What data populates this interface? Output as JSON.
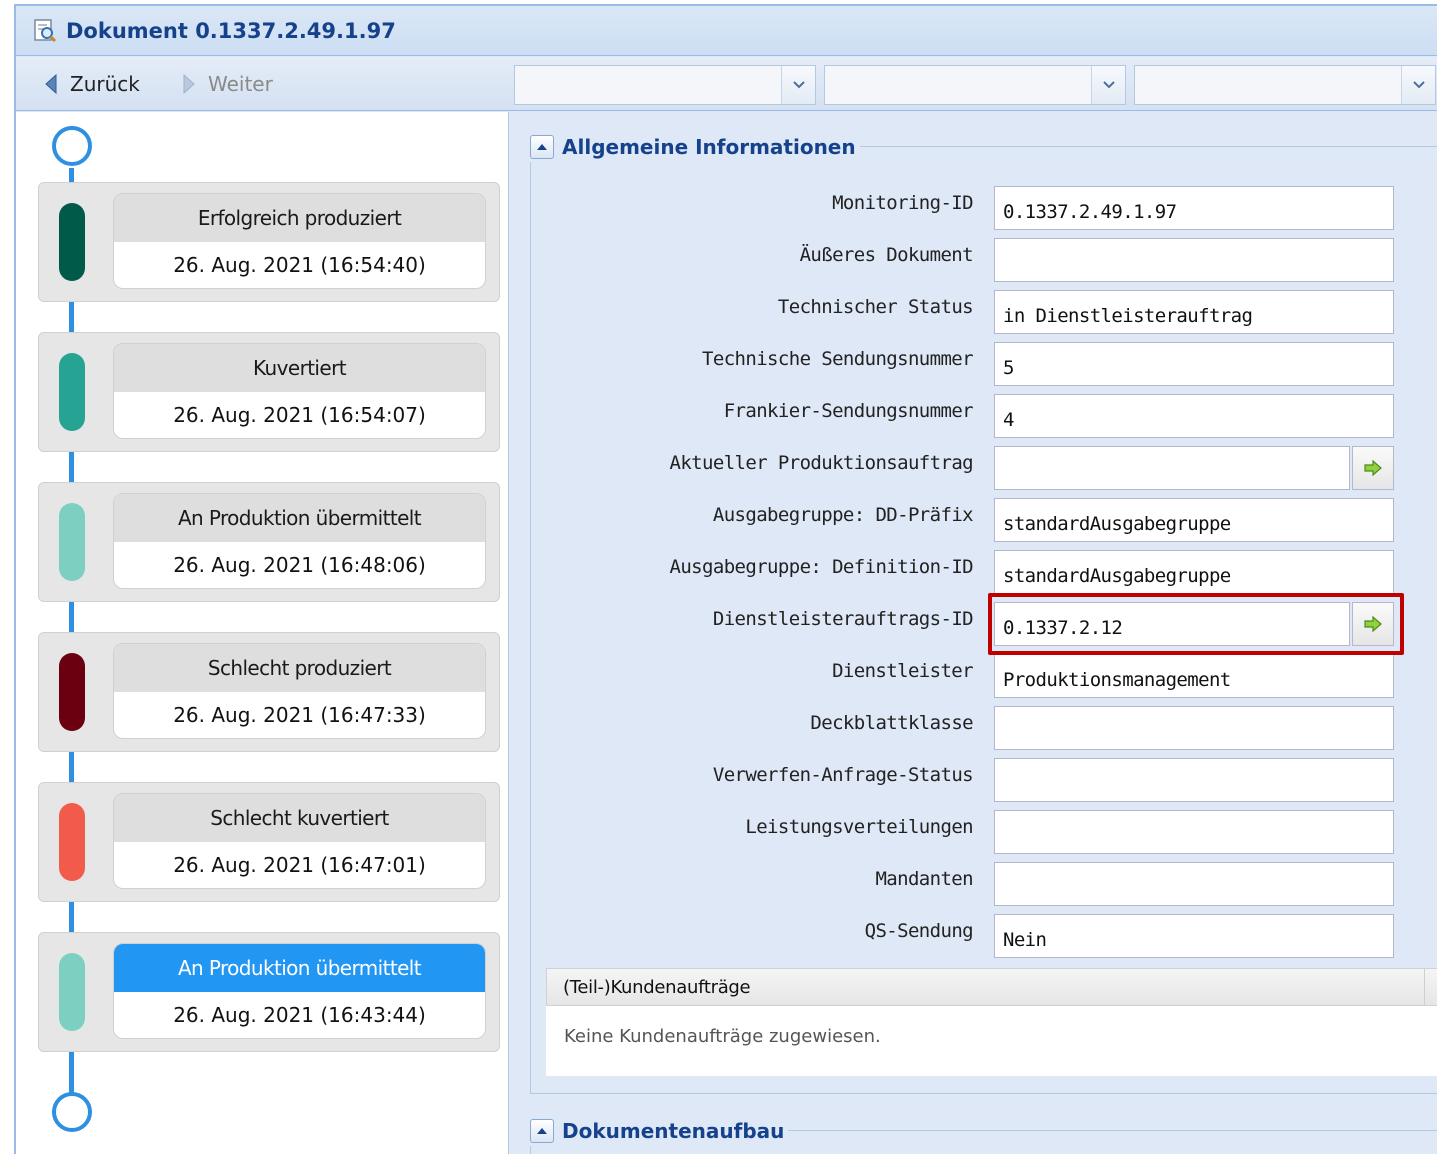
{
  "window": {
    "title": "Dokument 0.1337.2.49.1.97",
    "title_icon": "document-search-icon"
  },
  "toolbar": {
    "back_label": "Zurück",
    "forward_label": "Weiter",
    "combo_values": [
      "",
      "",
      ""
    ]
  },
  "timeline": {
    "events": [
      {
        "status": "Erfolgreich produziert",
        "date": "26. Aug. 2021 (16:54:40)",
        "color": "#005a4a",
        "active": false
      },
      {
        "status": "Kuvertiert",
        "date": "26. Aug. 2021 (16:54:07)",
        "color": "#26a392",
        "active": false
      },
      {
        "status": "An Produktion übermittelt",
        "date": "26. Aug. 2021 (16:48:06)",
        "color": "#7dcfc2",
        "active": false
      },
      {
        "status": "Schlecht produziert",
        "date": "26. Aug. 2021 (16:47:33)",
        "color": "#6b0010",
        "active": false
      },
      {
        "status": "Schlecht kuvertiert",
        "date": "26. Aug. 2021 (16:47:01)",
        "color": "#f25a4c",
        "active": false
      },
      {
        "status": "An Produktion übermittelt",
        "date": "26. Aug. 2021 (16:43:44)",
        "color": "#7dcfc2",
        "active": true
      }
    ],
    "line_color": "#2f8fe0"
  },
  "general_info": {
    "title": "Allgemeine Informationen",
    "fields": [
      {
        "label": "Monitoring-ID",
        "value": "0.1337.2.49.1.97"
      },
      {
        "label": "Äußeres Dokument",
        "value": ""
      },
      {
        "label": "Technischer Status",
        "value": "in Dienstleisterauftrag"
      },
      {
        "label": "Technische Sendungsnummer",
        "value": "5"
      },
      {
        "label": "Frankier-Sendungsnummer",
        "value": "4"
      },
      {
        "label": "Aktueller Produktionsauftrag",
        "value": ""
      },
      {
        "label": "Ausgabegruppe: DD-Präfix",
        "value": "standardAusgabegruppe"
      },
      {
        "label": "Ausgabegruppe: Definition-ID",
        "value": "standardAusgabegruppe"
      },
      {
        "label": "Dienstleisterauftrags-ID",
        "value": "0.1337.2.12"
      },
      {
        "label": "Dienstleister",
        "value": "Produktionsmanagement"
      },
      {
        "label": "Deckblattklasse",
        "value": ""
      },
      {
        "label": "Verwerfen-Anfrage-Status",
        "value": ""
      },
      {
        "label": "Leistungsverteilungen",
        "value": ""
      },
      {
        "label": "Mandanten",
        "value": ""
      },
      {
        "label": "QS-Sendung",
        "value": "Nein"
      }
    ],
    "highlight_color": "#c00000"
  },
  "customer_orders": {
    "header": "(Teil-)Kundenaufträge",
    "empty_text": "Keine Kundenaufträge zugewiesen."
  },
  "document_structure": {
    "title": "Dokumentenaufbau"
  }
}
